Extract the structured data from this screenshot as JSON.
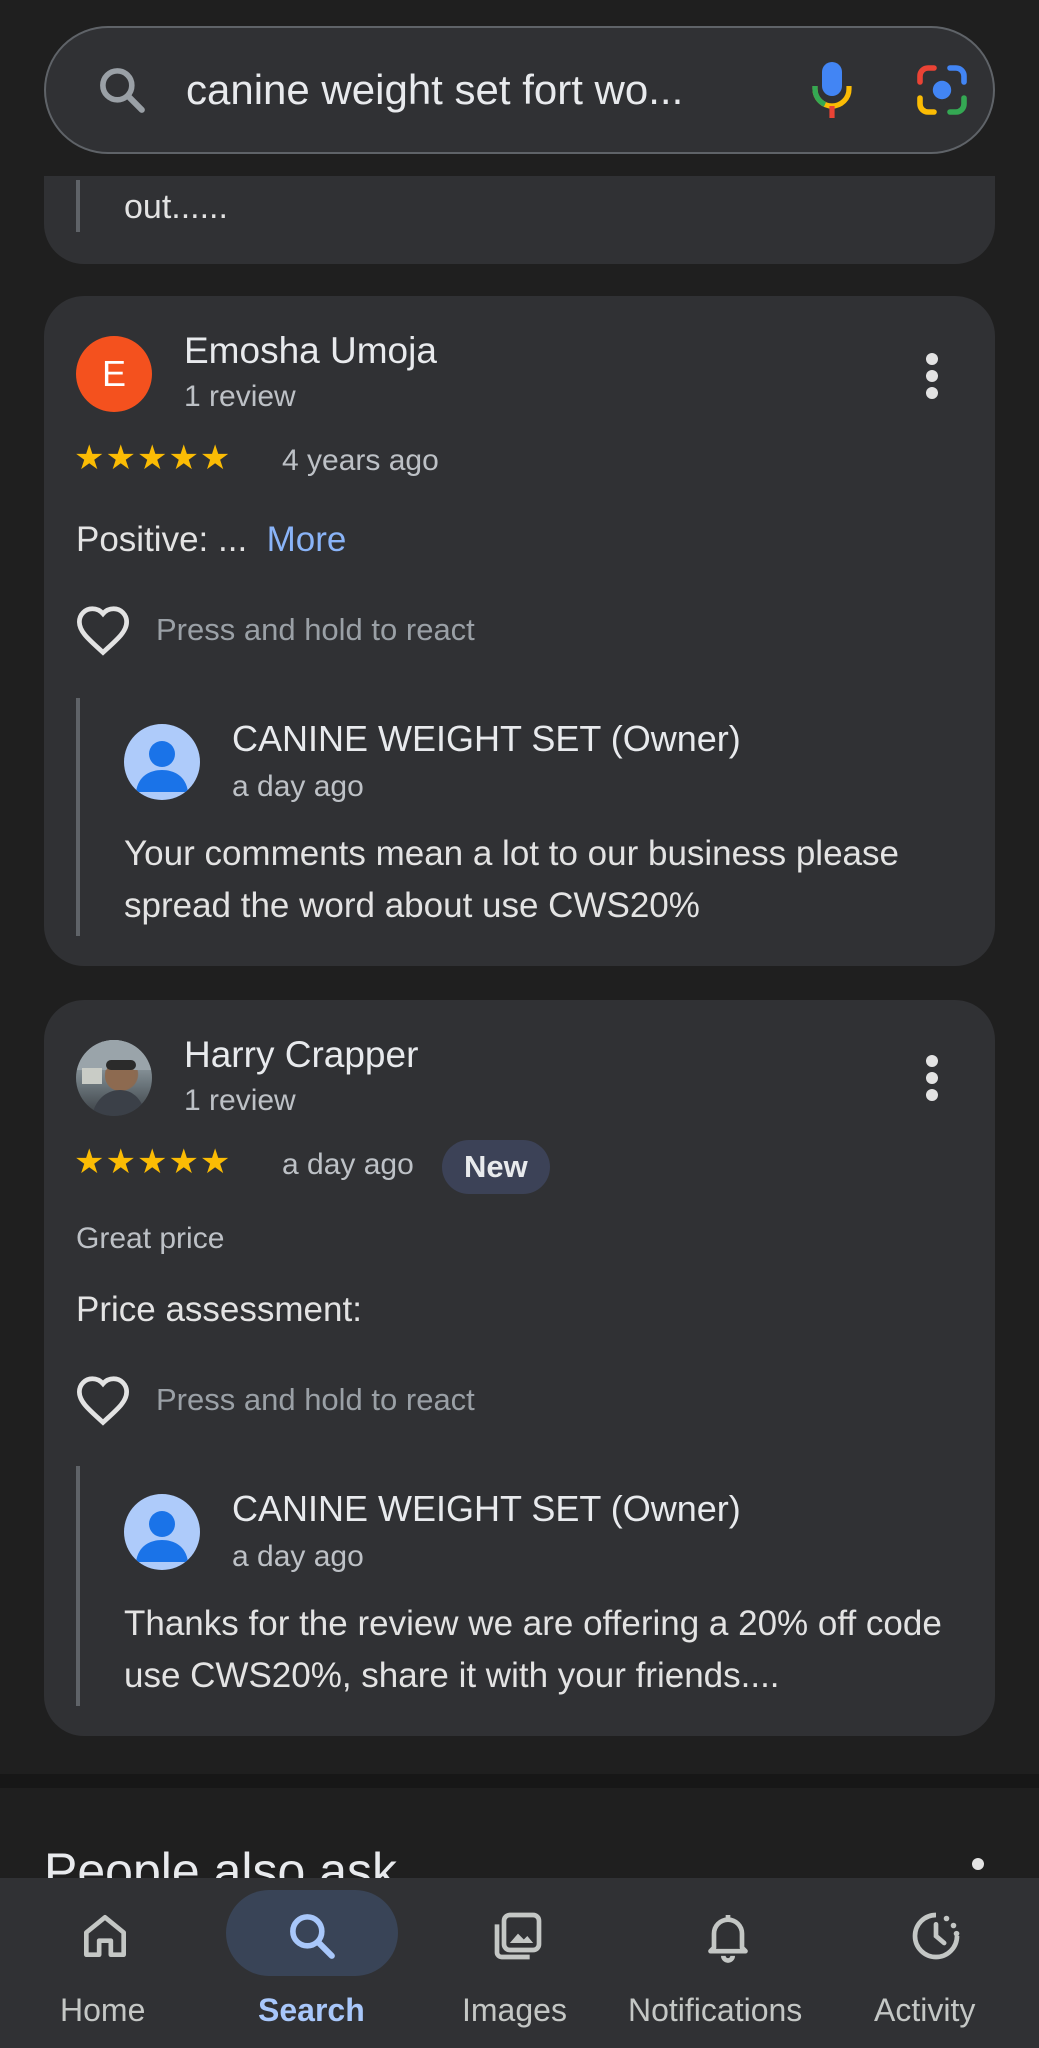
{
  "search": {
    "query": "canine weight set fort wo...",
    "icons": [
      "search-icon",
      "mic-icon",
      "lens-icon"
    ]
  },
  "partial_review": {
    "text": "out......"
  },
  "reviews": [
    {
      "avatar_letter": "E",
      "name": "Emosha Umoja",
      "review_count": "1 review",
      "stars": "★★★★★",
      "rating": 5,
      "time": "4 years ago",
      "body": "Positive: ...",
      "more_label": "More",
      "react_label": "Press and hold to react",
      "owner_reply": {
        "name": "CANINE WEIGHT SET (Owner)",
        "time": "a day ago",
        "text": "Your comments mean a lot to our business please spread the word about use CWS20%"
      }
    },
    {
      "name": "Harry Crapper",
      "review_count": "1 review",
      "stars": "★★★★★",
      "rating": 5,
      "time": "a day ago",
      "badge": "New",
      "tag": "Great price",
      "body": "Price assessment:",
      "react_label": "Press and hold to react",
      "owner_reply": {
        "name": "CANINE WEIGHT SET (Owner)",
        "time": "a day ago",
        "text": "Thanks for the review we are offering a 20% off code use CWS20%, share it with your friends...."
      }
    }
  ],
  "people_also_ask": {
    "title": "People also ask"
  },
  "bottom_nav": {
    "items": [
      {
        "label": "Home",
        "icon": "home-icon",
        "active": false
      },
      {
        "label": "Search",
        "icon": "search-icon",
        "active": true
      },
      {
        "label": "Images",
        "icon": "images-icon",
        "active": false
      },
      {
        "label": "Notifications",
        "icon": "bell-icon",
        "active": false
      },
      {
        "label": "Activity",
        "icon": "activity-icon",
        "active": false
      }
    ]
  },
  "colors": {
    "background": "#1f1f1f",
    "card": "#303134",
    "star": "#fbbc04",
    "link": "#8ab4f8",
    "active_nav": "#a8c7fa",
    "avatar_orange": "#f4511e"
  }
}
